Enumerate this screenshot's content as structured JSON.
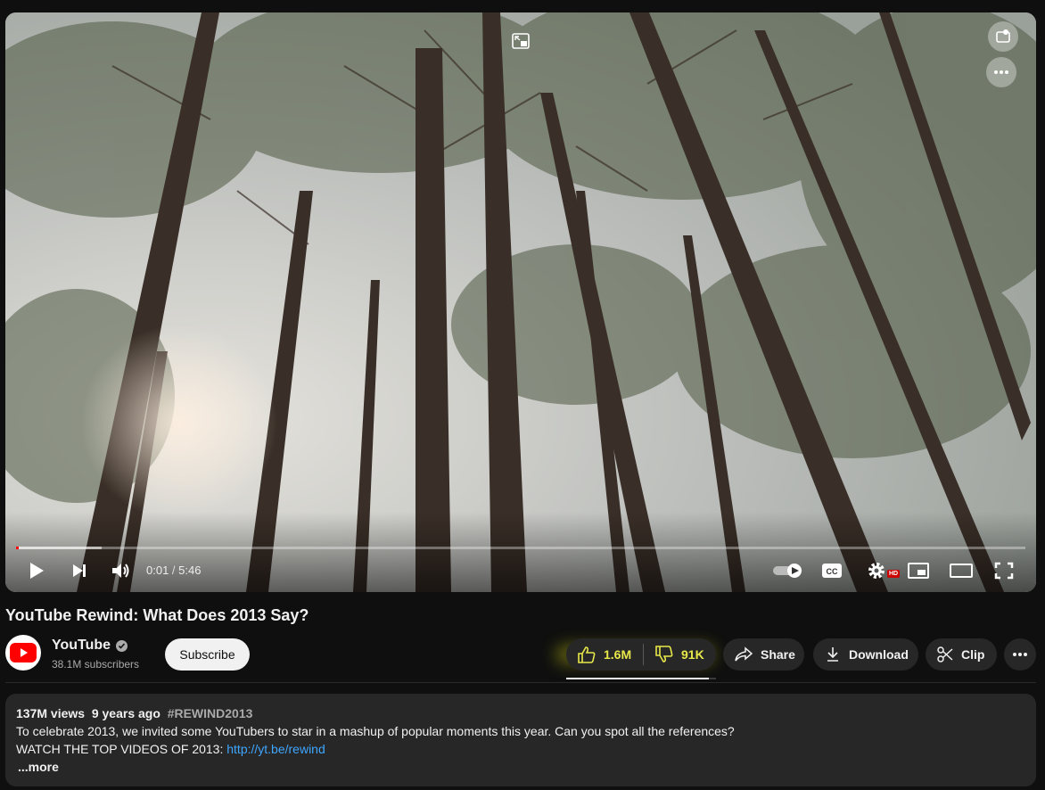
{
  "player": {
    "time_current": "0:01",
    "time_separator": " / ",
    "time_total": "5:46",
    "progress_played": 0.003,
    "progress_loaded": 0.085,
    "hd_badge": "HD",
    "icons": [
      "miniplayer-icon",
      "channel-watermark-icon",
      "overflow-menu-icon",
      "play-icon",
      "next-icon",
      "volume-icon",
      "autoplay-toggle-icon",
      "captions-icon",
      "settings-icon",
      "miniplayer-icon",
      "theater-mode-icon",
      "fullscreen-icon"
    ]
  },
  "video": {
    "title": "YouTube Rewind: What Does 2013 Say?"
  },
  "channel": {
    "name": "YouTube",
    "subscribers": "38.1M subscribers",
    "subscribe_label": "Subscribe",
    "brand_color": "#ff0000"
  },
  "actions": {
    "likes": "1.6M",
    "dislikes": "91K",
    "like_ratio": 0.95,
    "share_label": "Share",
    "download_label": "Download",
    "clip_label": "Clip",
    "highlight_color": "#e8e84a"
  },
  "description": {
    "views": "137M views",
    "age": "9 years ago",
    "hashtag": "#REWIND2013",
    "line1": "To celebrate 2013, we invited some YouTubers to star in a mashup of popular moments this year. Can you spot all the references?",
    "line2_prefix": "WATCH THE TOP VIDEOS OF 2013: ",
    "link": "http://yt.be/rewind",
    "more_label": "...more"
  }
}
